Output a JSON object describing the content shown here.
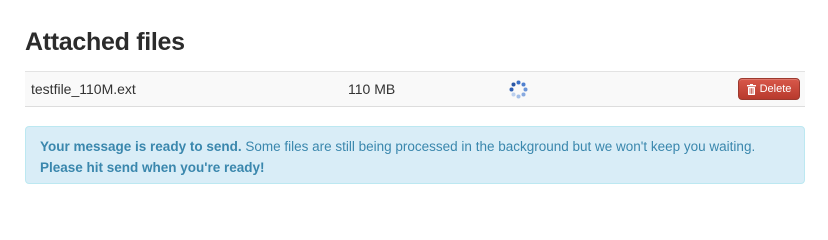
{
  "page": {
    "title": "Attached files"
  },
  "files": [
    {
      "name": "testfile_110M.ext",
      "size": "110 MB",
      "status_icon": "spinner-icon",
      "delete_label": "Delete",
      "delete_icon": "trash-icon"
    }
  ],
  "alert": {
    "lead": "Your message is ready to send.",
    "body": " Some files are still being processed in the background but we won't keep you waiting. ",
    "cta": "Please hit send when you're ready!"
  },
  "colors": {
    "alert_background": "#d9edf7",
    "alert_text": "#3a87ad",
    "delete_button": "#c9473a"
  }
}
